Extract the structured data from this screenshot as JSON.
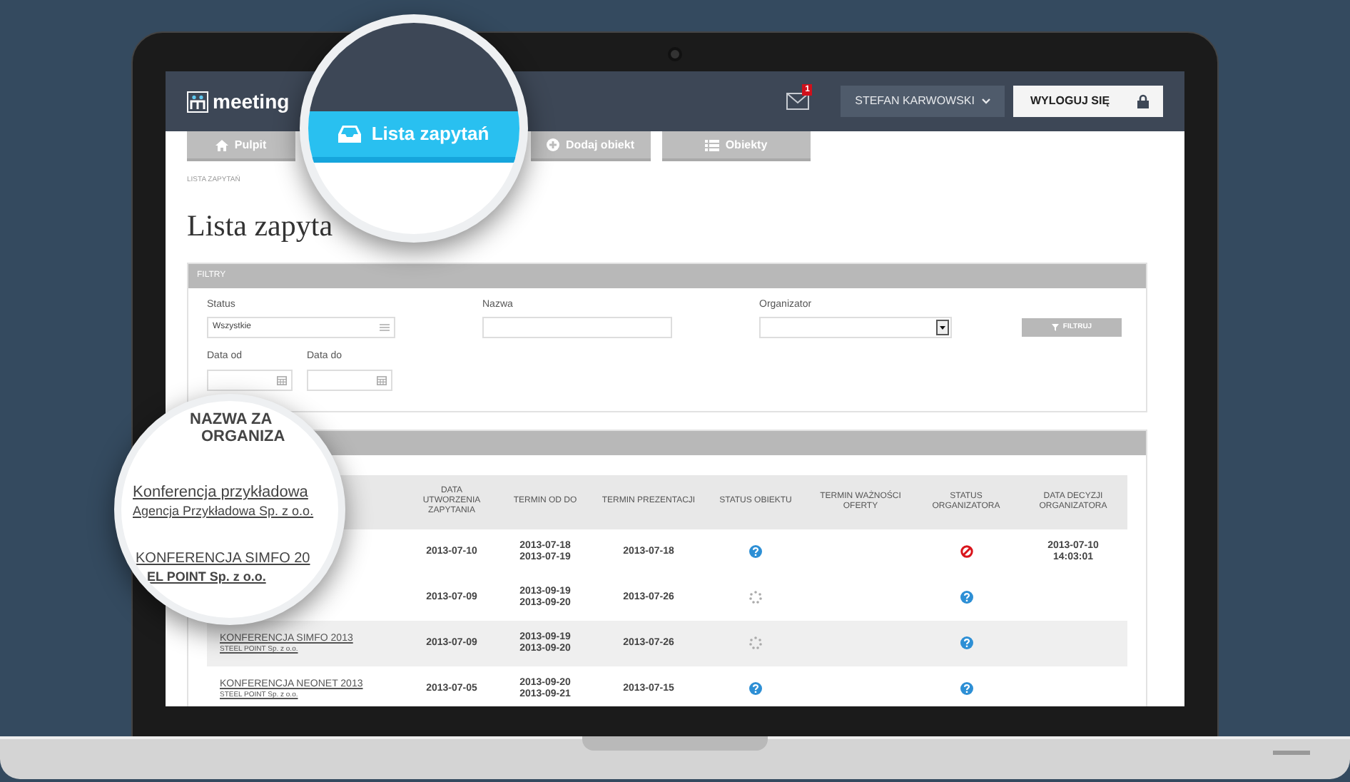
{
  "app": {
    "logo": "meeting",
    "notification_count": "1",
    "user": "STEFAN KARWOWSKI",
    "logout": "WYLOGUJ SIĘ"
  },
  "nav_tabs": [
    {
      "label": "Pulpit",
      "selected": false
    },
    {
      "label": "Lista zapytań",
      "selected": true
    },
    {
      "label": "Dodaj obiekt",
      "selected": false
    },
    {
      "label": "Obiekty",
      "selected": false
    }
  ],
  "breadcrumb": "LISTA ZAPYTAŃ",
  "heading": "Lista zapyta",
  "filters": {
    "title": "FILTRY",
    "button": "FILTRUJ",
    "fields": [
      {
        "label": "Status",
        "kind": "select",
        "value": "Wszystkie"
      },
      {
        "label": "Nazwa",
        "kind": "text"
      },
      {
        "label": "Organizator",
        "kind": "dropdown"
      },
      {
        "label": "Data od",
        "kind": "date"
      },
      {
        "label": "Data do",
        "kind": "date"
      }
    ]
  },
  "table": {
    "columns": [
      "DATA UTWORZENIA ZAPYTANIA",
      "TERMIN OD DO",
      "TERMIN PREZENTACJI",
      "STATUS OBIEKTU",
      "TERMIN WAŻNOŚCI OFERTY",
      "STATUS ORGANIZATORA",
      "DATA DECYZJI ORGANIZATORA"
    ],
    "rows": [
      {
        "created": "2013-07-10",
        "term_from": "2013-07-18",
        "term_to": "2013-07-19",
        "presentation": "2013-07-18",
        "object_status": {
          "kind": "question"
        },
        "organizer_status": {
          "kind": "rejected"
        },
        "decision_date": "2013-07-10",
        "decision_time": "14:03:01"
      },
      {
        "created": "2013-07-09",
        "term_from": "2013-09-19",
        "term_to": "2013-09-20",
        "presentation": "2013-07-26",
        "object_status": {
          "kind": "pending"
        },
        "organizer_status": {
          "kind": "question"
        }
      },
      {
        "name": "KONFERENCJA SIMFO 2013",
        "org": "STEEL POINT Sp. z o.o.",
        "created": "2013-07-09",
        "term_from": "2013-09-19",
        "term_to": "2013-09-20",
        "presentation": "2013-07-26",
        "object_status": {
          "kind": "pending"
        },
        "organizer_status": {
          "kind": "question"
        }
      },
      {
        "name": "KONFERENCJA NEONET 2013",
        "org": "STEEL POINT Sp. z o.o.",
        "created": "2013-07-05",
        "term_from": "2013-09-20",
        "term_to": "2013-09-21",
        "presentation": "2013-07-15",
        "object_status": {
          "kind": "question"
        },
        "organizer_status": {
          "kind": "question"
        }
      }
    ]
  },
  "magnifier_list": {
    "header": [
      "NAZWA ZA",
      "ORGANIZA"
    ],
    "items": [
      {
        "name": "Konferencja przykładowa",
        "org": "Agencja Przykładowa Sp. z o.o.",
        "kind": "lower"
      },
      {
        "name": "KONFERENCJA SIMFO 20",
        "org": "EL POINT Sp. z o.o.",
        "kind": "upper"
      }
    ]
  }
}
